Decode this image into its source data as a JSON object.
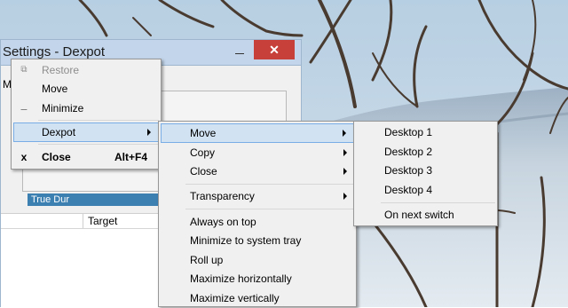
{
  "window": {
    "title": "Settings - Dexpot",
    "menu_first_letter": "M",
    "close_glyph": "✕",
    "list_selected_row": "True Dur",
    "column_target": "Target"
  },
  "system_menu": {
    "items": [
      {
        "label": "Restore",
        "disabled": true,
        "icon": "restore-icon"
      },
      {
        "label": "Move"
      },
      {
        "label": "Minimize",
        "icon": "minimize-icon"
      },
      {
        "label": "Dexpot",
        "submenu": true,
        "highlighted": true
      },
      {
        "label": "Close",
        "shortcut": "Alt+F4",
        "bold": true,
        "icon": "close-x-icon"
      }
    ],
    "icon_glyphs": {
      "restore": "⧉",
      "minimize": "_",
      "close": "x"
    }
  },
  "dexpot_menu": {
    "items": [
      {
        "label": "Move",
        "submenu": true,
        "highlighted": true
      },
      {
        "label": "Copy",
        "submenu": true
      },
      {
        "label": "Close",
        "submenu": true
      },
      {
        "label": "Transparency",
        "submenu": true
      },
      {
        "label": "Always on top"
      },
      {
        "label": "Minimize to system tray"
      },
      {
        "label": "Roll up"
      },
      {
        "label": "Maximize horizontally"
      },
      {
        "label": "Maximize vertically"
      }
    ]
  },
  "move_menu": {
    "items": [
      {
        "label": "Desktop 1"
      },
      {
        "label": "Desktop 2"
      },
      {
        "label": "Desktop 3"
      },
      {
        "label": "Desktop 4"
      },
      {
        "label": "On next switch"
      }
    ]
  },
  "colors": {
    "menu_background": "#f0f0f0",
    "highlight_fill": "#d1e2f2",
    "highlight_border": "#78aee5",
    "titlebar_close": "#c7403a"
  }
}
